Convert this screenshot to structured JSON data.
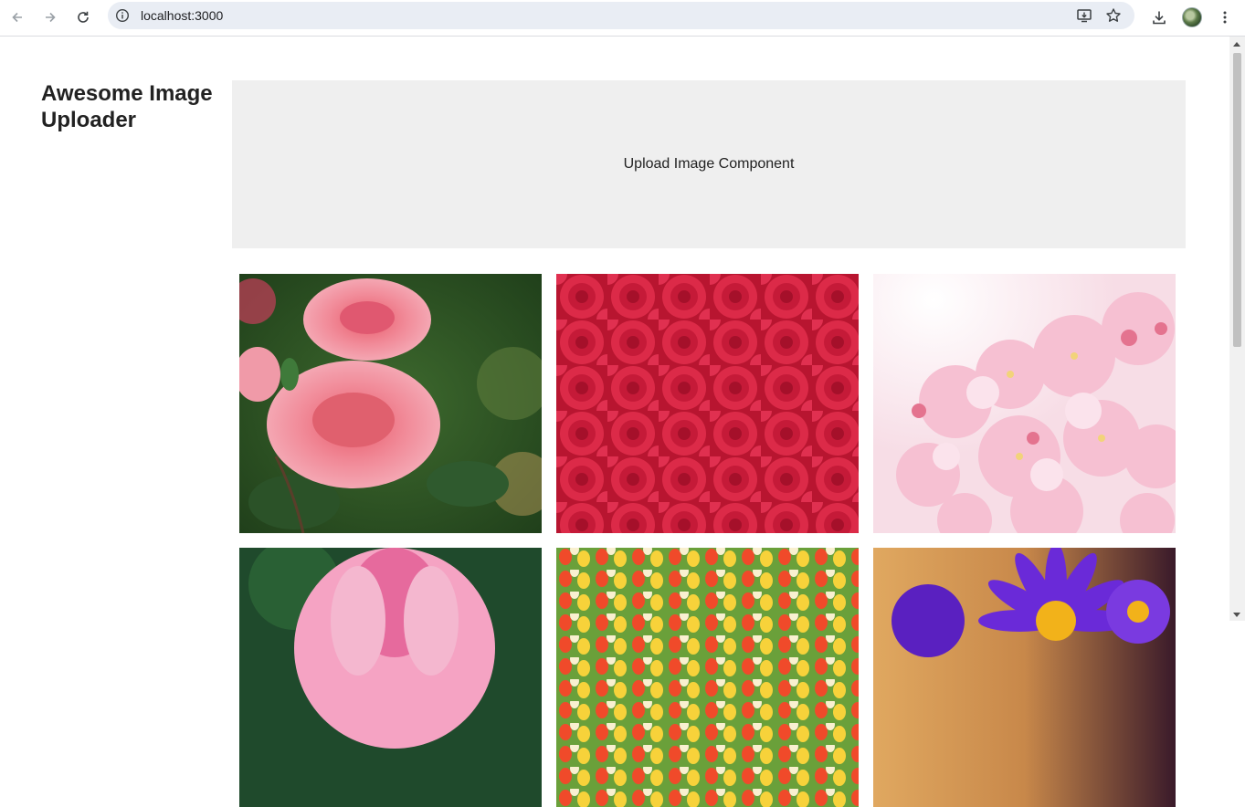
{
  "browser": {
    "url": "localhost:3000"
  },
  "page": {
    "title": "Awesome Image Uploader",
    "upload_component_label": "Upload Image Component"
  },
  "gallery": {
    "images": [
      {
        "subject": "pink roses"
      },
      {
        "subject": "red roses"
      },
      {
        "subject": "pink cherry blossoms"
      },
      {
        "subject": "pink lotus"
      },
      {
        "subject": "tulip field"
      },
      {
        "subject": "purple daisies"
      }
    ]
  }
}
